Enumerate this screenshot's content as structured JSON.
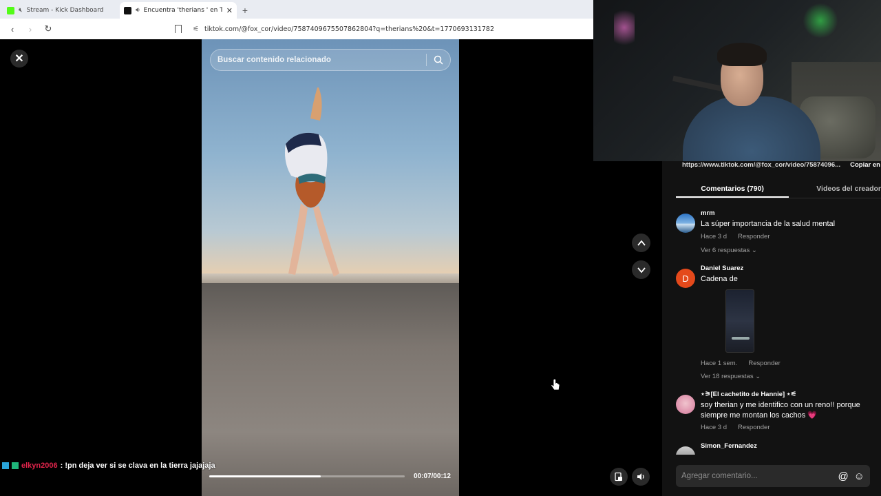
{
  "browser": {
    "tabs": [
      {
        "label": "Stream - Kick Dashboard",
        "active": false
      },
      {
        "label": "Encuentra 'therians ' en TikTok",
        "active": true
      }
    ],
    "new_tab": "+",
    "url": "tiktok.com/@fox_cor/video/7587409675507862804?q=therians%20&t=1770693131782"
  },
  "video": {
    "search_placeholder": "Buscar contenido relacionado",
    "time": "00:07/00:12",
    "progress_fraction": 0.57
  },
  "chat": {
    "user": "elkyn2006",
    "message": ": !pn deja ver si se clava en la tierra jajajaja"
  },
  "panel": {
    "url_text": "https://www.tiktok.com/@fox_cor/video/75874096...",
    "copy_label": "Copiar en",
    "tabs": [
      "Comentarios (790)",
      "Videos del creador"
    ],
    "comments": [
      {
        "name": "mrm",
        "text": "La súper importancia de la salud mental",
        "time": "Hace 3 d",
        "reply": "Responder",
        "replies": "Ver 6 respuestas ⌄"
      },
      {
        "name": "Daniel Suarez",
        "avatar_letter": "D",
        "text": "Cadena de",
        "time": "Hace 1 sem.",
        "reply": "Responder",
        "replies": "Ver 18 respuestas ⌄"
      },
      {
        "name": "⋆⚞[El cachetito de Hannie] ⋆⚟",
        "text": "soy therian y me identifico con un reno!! porque siempre me montan los cachos",
        "heart": "💗",
        "time": "Hace 3 d",
        "reply": "Responder"
      },
      {
        "name": "Simon_Fernandez"
      }
    ],
    "add_placeholder": "Agregar comentario...",
    "mention_icon": "@",
    "emoji_icon": "☺"
  },
  "colors": {
    "accent": "#fe2c55",
    "chat_user": "#e0244b",
    "kick_green": "#53fc18"
  }
}
